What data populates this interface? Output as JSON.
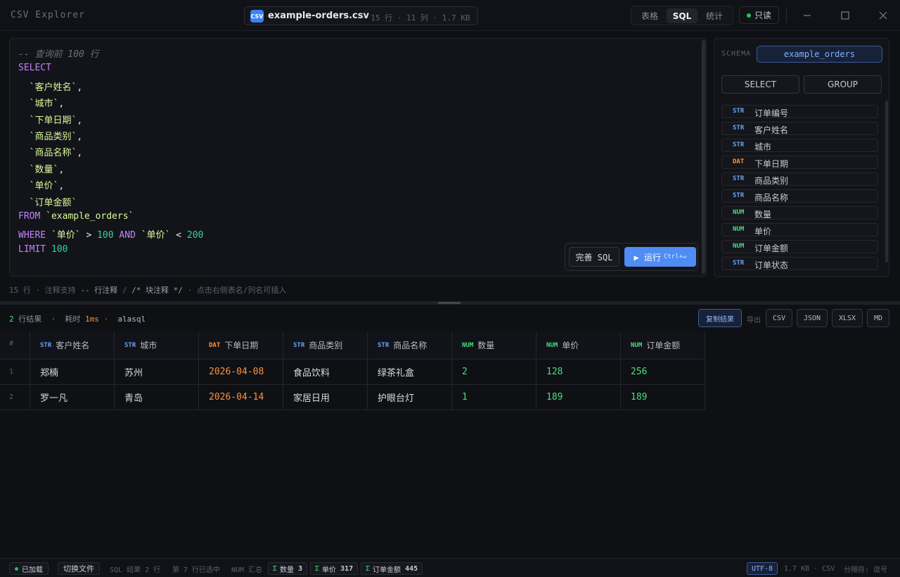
{
  "app": {
    "title": "CSV Explorer",
    "file_badge": "CSV",
    "file_name": "example-orders.csv",
    "file_meta": "· 15 行 · 11 列 · 1.7 KB",
    "modes": [
      "表格",
      "SQL",
      "统计"
    ],
    "active_mode": "SQL",
    "readonly_label": "只读",
    "accent": "#4f8df5"
  },
  "editor": {
    "lines": [
      [
        {
          "t": "-- 查询前 100 行",
          "c": "c-comment"
        }
      ],
      [
        {
          "t": "SELECT",
          "c": "c-kw"
        }
      ],
      [
        {
          "t": "  `客户姓名`",
          "c": "c-str"
        },
        {
          "t": ",",
          "c": "c-op"
        }
      ],
      [
        {
          "t": "  `城市`",
          "c": "c-str"
        },
        {
          "t": ",",
          "c": "c-op"
        }
      ],
      [
        {
          "t": "  `下单日期`",
          "c": "c-str"
        },
        {
          "t": ",",
          "c": "c-op"
        }
      ],
      [
        {
          "t": "  `商品类别`",
          "c": "c-str"
        },
        {
          "t": ",",
          "c": "c-op"
        }
      ],
      [
        {
          "t": "  `商品名称`",
          "c": "c-str"
        },
        {
          "t": ",",
          "c": "c-op"
        }
      ],
      [
        {
          "t": "  `数量`",
          "c": "c-str"
        },
        {
          "t": ",",
          "c": "c-op"
        }
      ],
      [
        {
          "t": "  `单价`",
          "c": "c-str"
        },
        {
          "t": ",",
          "c": "c-op"
        }
      ],
      [
        {
          "t": "  `订单金额`",
          "c": "c-str"
        }
      ],
      [
        {
          "t": "FROM ",
          "c": "c-kw"
        },
        {
          "t": "`example_orders`",
          "c": "c-str"
        }
      ],
      [
        {
          "t": "WHERE ",
          "c": "c-kw"
        },
        {
          "t": "`单价`",
          "c": "c-str"
        },
        {
          "t": " > ",
          "c": "c-op"
        },
        {
          "t": "100",
          "c": "c-num"
        },
        {
          "t": " AND ",
          "c": "c-kw"
        },
        {
          "t": "`单价`",
          "c": "c-str"
        },
        {
          "t": " < ",
          "c": "c-op"
        },
        {
          "t": "200",
          "c": "c-num"
        }
      ],
      [
        {
          "t": "LIMIT ",
          "c": "c-kw"
        },
        {
          "t": "100",
          "c": "c-num"
        }
      ]
    ],
    "complete_label": "完善 SQL",
    "run_label": "▶ 运行",
    "run_shortcut": "Ctrl+↵"
  },
  "schema": {
    "label": "SCHEMA",
    "table": "example_orders",
    "buttons": [
      "SELECT",
      "GROUP"
    ],
    "columns": [
      {
        "type": "STR",
        "name": "订单编号"
      },
      {
        "type": "STR",
        "name": "客户姓名"
      },
      {
        "type": "STR",
        "name": "城市"
      },
      {
        "type": "DAT",
        "name": "下单日期"
      },
      {
        "type": "STR",
        "name": "商品类别"
      },
      {
        "type": "STR",
        "name": "商品名称"
      },
      {
        "type": "NUM",
        "name": "数量"
      },
      {
        "type": "NUM",
        "name": "单价"
      },
      {
        "type": "NUM",
        "name": "订单金额"
      },
      {
        "type": "STR",
        "name": "订单状态"
      }
    ]
  },
  "hint": {
    "prefix": "15 行 · 注释支持 ",
    "line_comment": "-- 行注释",
    "slash": " / ",
    "block_comment": "/* 块注释 */",
    "suffix": " · 点击右侧表名/列名可插入"
  },
  "results": {
    "count": "2",
    "count_label": " 行结果  ·  耗时 ",
    "time": "1ms",
    "engine_sep": " ·  ",
    "engine": "alasql",
    "copy_label": "复制结果",
    "export_label": "导出",
    "export_formats": [
      "CSV",
      "JSON",
      "XLSX",
      "MD"
    ],
    "index_header": "#",
    "headers": [
      {
        "type": "STR",
        "name": "客户姓名"
      },
      {
        "type": "STR",
        "name": "城市"
      },
      {
        "type": "DAT",
        "name": "下单日期"
      },
      {
        "type": "STR",
        "name": "商品类别"
      },
      {
        "type": "STR",
        "name": "商品名称"
      },
      {
        "type": "NUM",
        "name": "数量"
      },
      {
        "type": "NUM",
        "name": "单价"
      },
      {
        "type": "NUM",
        "name": "订单金额"
      }
    ],
    "rows": [
      {
        "index": "1",
        "cells": [
          "郑楠",
          "苏州",
          "2026-04-08",
          "食品饮料",
          "绿茶礼盒",
          "2",
          "128",
          "256"
        ]
      },
      {
        "index": "2",
        "cells": [
          "罗一凡",
          "青岛",
          "2026-04-14",
          "家居日用",
          "护眼台灯",
          "1",
          "189",
          "189"
        ]
      }
    ]
  },
  "status": {
    "loaded": "已加载",
    "switch_file": "切换文件",
    "sql_result": "SQL 结果 2 行",
    "selected": "第 7 行已选中",
    "num_sum_label": "NUM 汇总",
    "sums": [
      {
        "name": "数量",
        "value": "3"
      },
      {
        "name": "单价",
        "value": "317"
      },
      {
        "name": "订单金额",
        "value": "445"
      }
    ],
    "encoding": "UTF-8",
    "file_info": "1.7 KB · CSV",
    "delimiter": "分隔符: 逗号"
  }
}
